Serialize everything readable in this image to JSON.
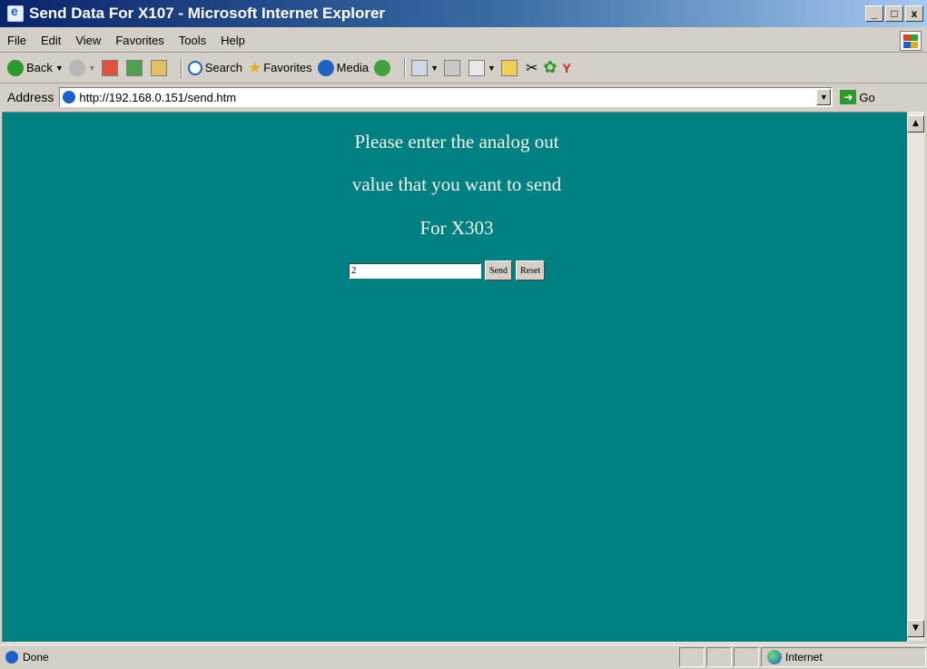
{
  "window": {
    "title": "Send Data For X107 - Microsoft Internet Explorer",
    "buttons": [
      "_",
      "□",
      "x"
    ]
  },
  "menu": {
    "items": [
      "File",
      "Edit",
      "View",
      "Favorites",
      "Tools",
      "Help"
    ]
  },
  "toolbar": {
    "back": "Back",
    "search": "Search",
    "favorites": "Favorites",
    "media": "Media"
  },
  "address": {
    "label": "Address",
    "url": "http://192.168.0.151/send.htm",
    "go": "Go"
  },
  "page": {
    "line1": "Please enter the analog out",
    "line2": "value that you want to send",
    "line3": "For X303",
    "input_value": "2",
    "send_label": "Send",
    "reset_label": "Reset",
    "background": "#008080"
  },
  "status": {
    "left": "Done",
    "zone": "Internet"
  }
}
